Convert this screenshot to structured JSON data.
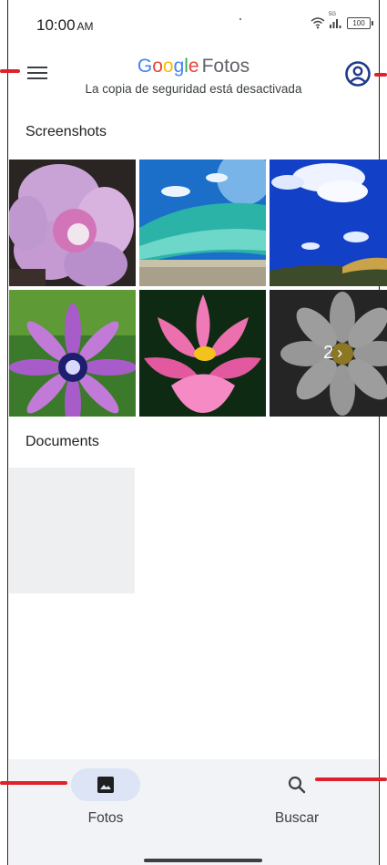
{
  "status_bar": {
    "time": "10:00",
    "ampm": "AM",
    "network_label": "5G",
    "battery": "100"
  },
  "app_bar": {
    "brand_letters": [
      "G",
      "o",
      "o",
      "g",
      "l",
      "e"
    ],
    "product": "Fotos",
    "subtitle": "La copia de seguridad está desactivada",
    "menu_icon": "hamburger-menu-icon",
    "account_icon": "account-circle-icon"
  },
  "sections": {
    "screenshots": {
      "title": "Screenshots",
      "thumbnails": [
        "pink-flower",
        "ocean-wave",
        "blue-sky-clouds",
        "purple-daisy",
        "pink-lotus",
        "white-flower"
      ],
      "more_count": "2",
      "more_chevron": "›"
    },
    "documents": {
      "title": "Documents"
    }
  },
  "bottom_nav": {
    "items": [
      {
        "label": "Fotos",
        "icon": "photo-icon",
        "active": true
      },
      {
        "label": "Buscar",
        "icon": "search-icon",
        "active": false
      }
    ]
  },
  "colors": {
    "google_blue": "#4285f4",
    "google_red": "#ea4335",
    "google_yellow": "#fbbc05",
    "google_green": "#34a853",
    "active_pill": "#dce4f6",
    "nav_background": "#f1f3f6",
    "annotation_marker": "#e0202a"
  }
}
